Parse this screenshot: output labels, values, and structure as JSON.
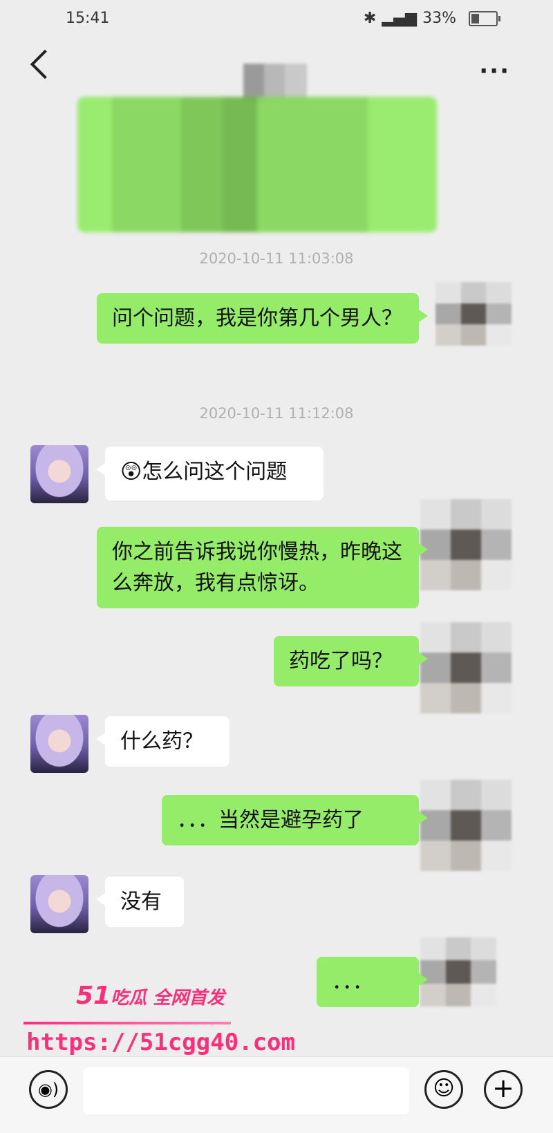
{
  "status": {
    "time": "15:41",
    "battery": "33%",
    "battery_level": 0.33
  },
  "header": {
    "back_icon": "back-chevron-icon",
    "more_icon": "more-dots-icon",
    "more_label": "···"
  },
  "messages": {
    "ts1": "2020-10-11 11:03:08",
    "m1": "问个问题，我是你第几个男人？",
    "ts2": "2020-10-11 11:12:08",
    "m2_emoji": "😲",
    "m2": "怎么问这个问题",
    "m3": "你之前告诉我说你慢热，昨晚这么奔放，我有点惊讶。",
    "m4": "药吃了吗？",
    "m5": "什么药？",
    "m6": "．．．当然是避孕药了",
    "m7": "没有",
    "m8": "．．．"
  },
  "watermark": {
    "line1_num": "51",
    "line1_text": "吃瓜 全网首发",
    "line2": "https://51cgg40.com"
  },
  "inputbar": {
    "voice_label": "◉)",
    "emoji_label": "☺",
    "plus_label": "+"
  },
  "colors": {
    "bubble_me": "#95ec69",
    "bubble_them": "#ffffff",
    "watermark": "#ff2d7a"
  }
}
